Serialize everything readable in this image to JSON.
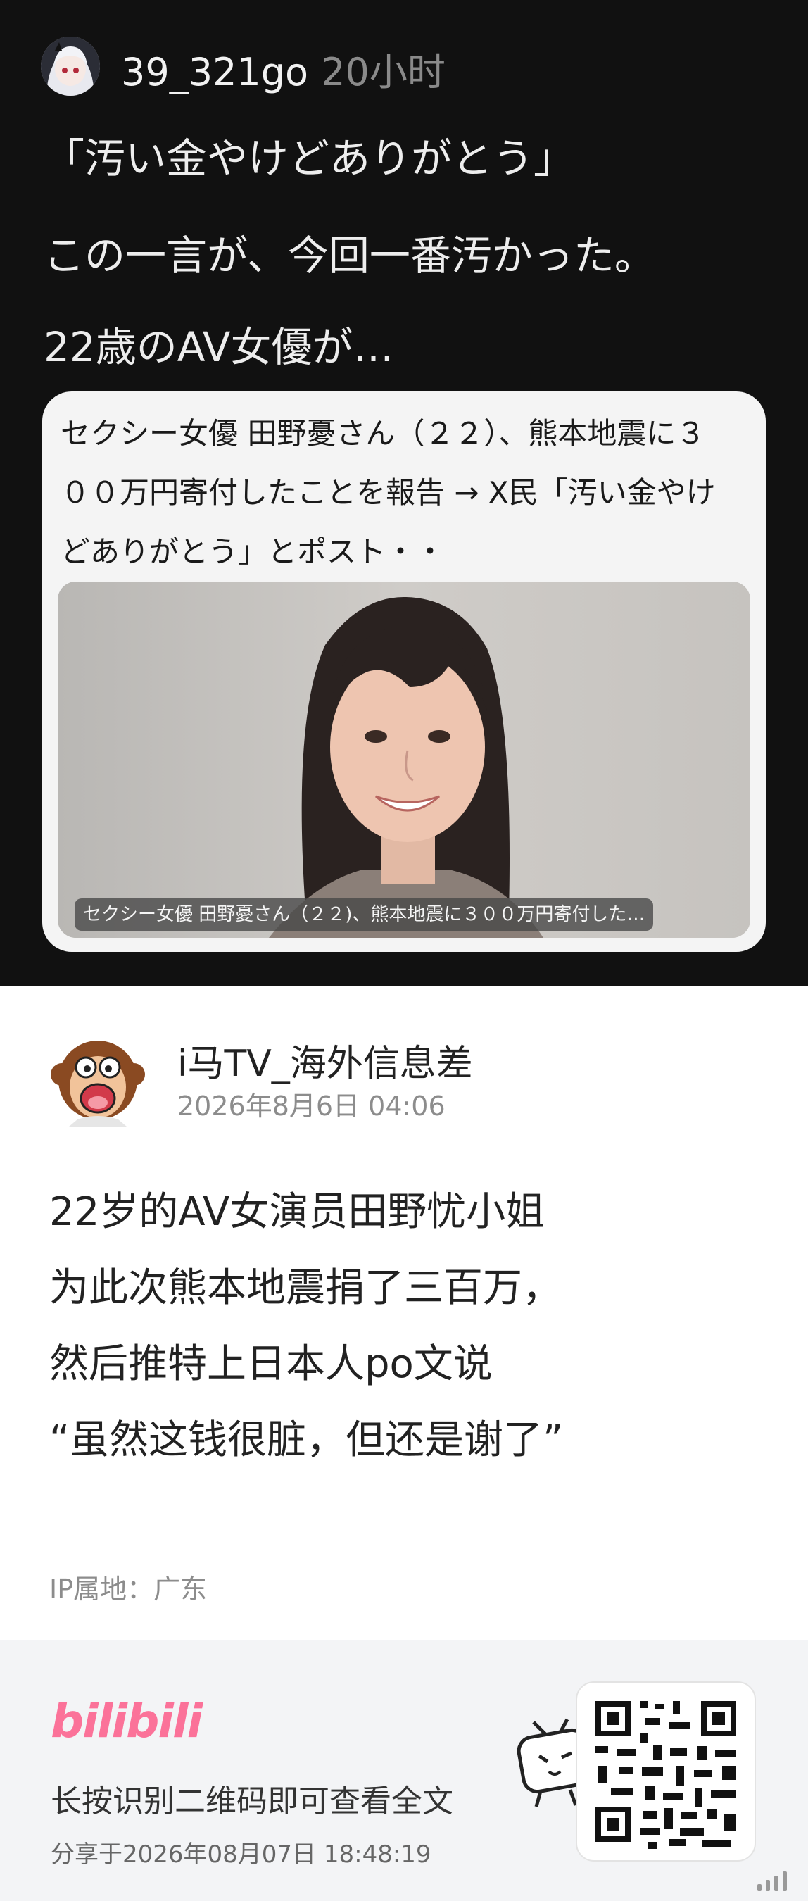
{
  "embedded_post": {
    "username": "39_321go",
    "time": "20小时",
    "lines": [
      "「汚い金やけどありがとう」",
      "この一言が、今回一番汚かった。",
      "22歳のAV女優が…"
    ],
    "card": {
      "headline_lines": [
        "セクシー女優 田野憂さん（２２）、熊本地震に３",
        "００万円寄付したことを報告 → X民「汚い金やけ",
        "どありがとう」とポスト・・"
      ],
      "image_caption": "セクシー女優 田野憂さん（２２)、熊本地震に３００万円寄付した…"
    }
  },
  "post": {
    "author": "i马TV_海外信息差",
    "timestamp": "2026年8月6日 04:06",
    "lines": [
      "22岁的AV女演员田野忧小姐",
      "为此次熊本地震捐了三百万，",
      "然后推特上日本人po文说",
      "“虽然这钱很脏，但还是谢了”"
    ],
    "ip_location": "IP属地：广东"
  },
  "footer": {
    "logo": "bilibili",
    "hint": "长按识别二维码即可查看全文",
    "shared_at": "分享于2026年08月07日 18:48:19"
  },
  "colors": {
    "dark_bg": "#111111",
    "brand_pink": "#fb7299",
    "footer_bg": "#f3f4f6"
  },
  "icons": [
    "anime-avatar-icon",
    "monkey-avatar-icon",
    "bilibili-tv-mascot-icon",
    "qr-code-icon",
    "signal-bars-icon"
  ]
}
